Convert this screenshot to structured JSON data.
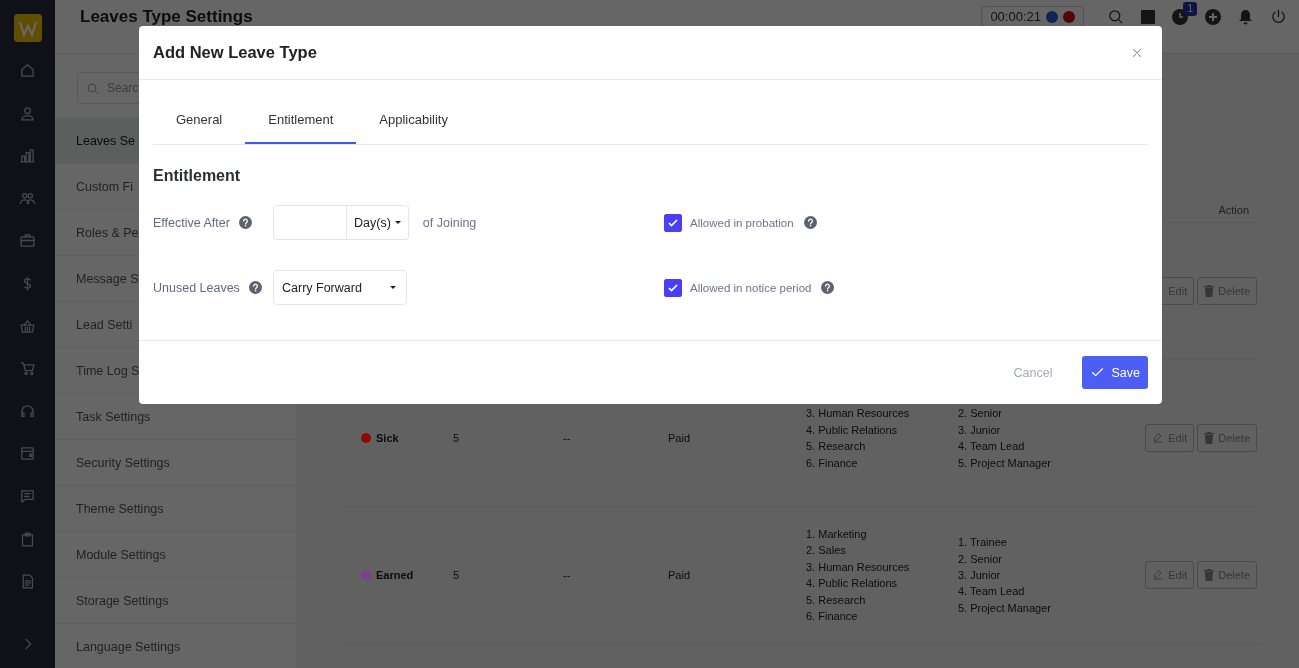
{
  "header": {
    "title": "Leaves Type Settings",
    "timer": "00:00:21",
    "notification_count": "1"
  },
  "settings_menu": {
    "search_placeholder": "Searc",
    "items": [
      {
        "label": "Leaves Se",
        "selected": true
      },
      {
        "label": "Custom Fi",
        "selected": false
      },
      {
        "label": "Roles & Pe",
        "selected": false
      },
      {
        "label": "Message S",
        "selected": false
      },
      {
        "label": "Lead Setti",
        "selected": false
      },
      {
        "label": "Time Log S",
        "selected": false
      },
      {
        "label": "Task Settings",
        "selected": false
      },
      {
        "label": "Security Settings",
        "selected": false
      },
      {
        "label": "Theme Settings",
        "selected": false
      },
      {
        "label": "Module Settings",
        "selected": false
      },
      {
        "label": "Storage Settings",
        "selected": false
      },
      {
        "label": "Language Settings",
        "selected": false
      }
    ]
  },
  "leave_table": {
    "columns": [
      "Action"
    ],
    "rows": [
      {
        "actions": [
          "Edit",
          "Delete"
        ]
      },
      {
        "name": "Sick",
        "color": "#8a0a0a",
        "column_2": "5",
        "column_3": "--",
        "column_4": "Paid",
        "column_5": [
          "3. Human Resources",
          "4. Public Relations",
          "5. Research",
          "6. Finance"
        ],
        "column_6": [
          "2. Senior",
          "3. Junior",
          "4. Team Lead",
          "5. Project Manager"
        ],
        "actions": [
          "Edit",
          "Delete"
        ]
      },
      {
        "name": "Earned",
        "color": "#7e3f8c",
        "column_2": "5",
        "column_3": "--",
        "column_4": "Paid",
        "column_5": [
          "1. Marketing",
          "2. Sales",
          "3. Human Resources",
          "4. Public Relations",
          "5. Research",
          "6. Finance"
        ],
        "column_6": [
          "1. Trainee",
          "2. Senior",
          "3. Junior",
          "4. Team Lead",
          "5. Project Manager"
        ],
        "actions": [
          "Edit",
          "Delete"
        ]
      }
    ]
  },
  "modal": {
    "title": "Add New Leave Type",
    "tabs": [
      {
        "label": "General",
        "selected": false
      },
      {
        "label": "Entitlement",
        "selected": true
      },
      {
        "label": "Applicability",
        "selected": false
      }
    ],
    "section_title": "Entitlement",
    "effective_after": {
      "label": "Effective After",
      "unit": "Day(s)",
      "suffix": "of Joining"
    },
    "unused_leaves": {
      "label": "Unused Leaves",
      "value": "Carry Forward"
    },
    "options": [
      {
        "label": "Allowed in probation",
        "checked": true
      },
      {
        "label": "Allowed in notice period",
        "checked": true
      }
    ],
    "buttons": {
      "cancel": "Cancel",
      "save": "Save"
    }
  }
}
